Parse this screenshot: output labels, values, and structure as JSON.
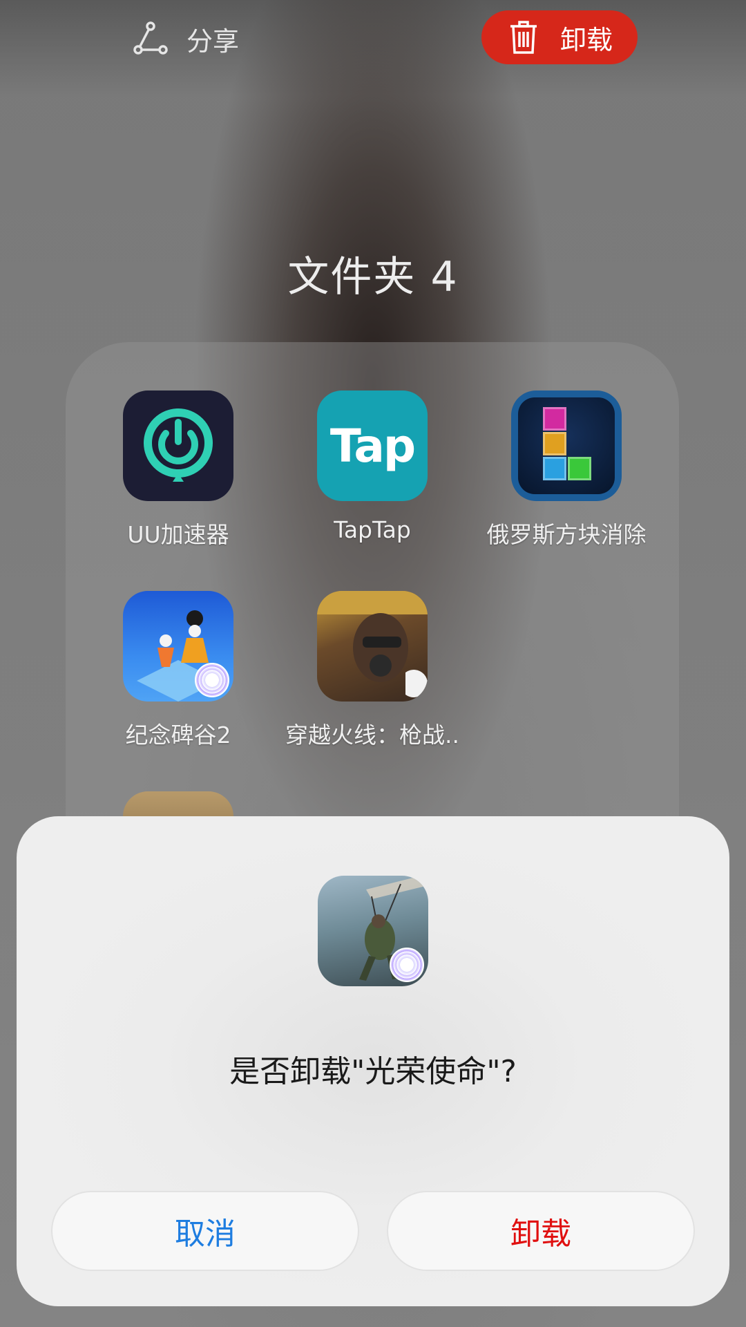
{
  "topbar": {
    "share_label": "分享",
    "share_icon": "share-icon",
    "uninstall_label": "卸载",
    "uninstall_icon": "trash-icon",
    "uninstall_color": "#d6271a"
  },
  "folder": {
    "title": "文件夹 4",
    "apps": [
      {
        "name": "UU加速器",
        "icon": "uu-accelerator-icon"
      },
      {
        "name": "TapTap",
        "icon": "taptap-icon",
        "icon_text": "Tap"
      },
      {
        "name": "俄罗斯方块消除",
        "icon": "tetris-icon"
      },
      {
        "name": "纪念碑谷2",
        "icon": "monument-valley-icon"
      },
      {
        "name": "穿越火线：枪战..",
        "icon": "crossfire-icon"
      }
    ]
  },
  "dialog": {
    "question": "是否卸载\"光荣使命\"?",
    "app_icon": "glory-mission-icon",
    "cancel_label": "取消",
    "confirm_label": "卸载",
    "cancel_color": "#1e7de0",
    "confirm_color": "#e01010"
  }
}
